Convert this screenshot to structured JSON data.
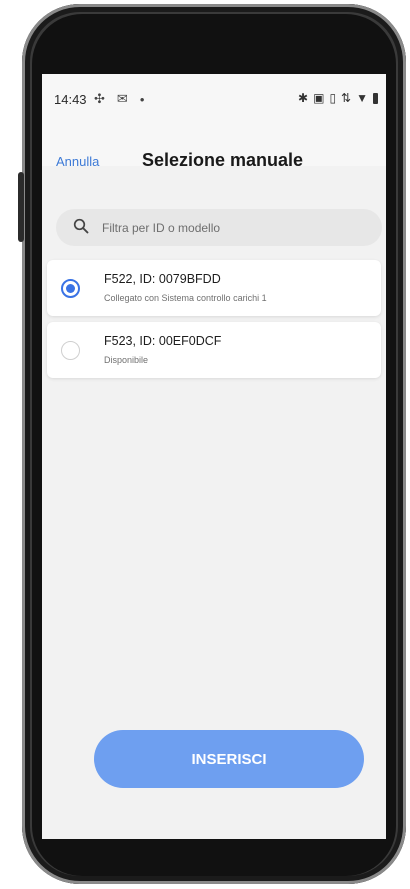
{
  "status_bar": {
    "time": "14:43",
    "left_icons": [
      "fan-icon",
      "mail-icon",
      "dot-icon"
    ],
    "right_icons": [
      "bluetooth-icon",
      "nfc-icon",
      "vibrate-icon",
      "data-icon",
      "wifi-icon",
      "battery-icon"
    ]
  },
  "header": {
    "cancel_label": "Annulla",
    "title": "Selezione manuale"
  },
  "search": {
    "placeholder": "Filtra per ID o modello",
    "value": ""
  },
  "devices": [
    {
      "title": "F522, ID: 0079BFDD",
      "subtitle": "Collegato con Sistema controllo carichi 1",
      "selected": true
    },
    {
      "title": "F523, ID: 00EF0DCF",
      "subtitle": "Disponibile",
      "selected": false
    }
  ],
  "actions": {
    "submit_label": "INSERISCI"
  },
  "colors": {
    "accent": "#3a73e5",
    "link": "#3d7ad6",
    "button": "#6e9ff0"
  }
}
